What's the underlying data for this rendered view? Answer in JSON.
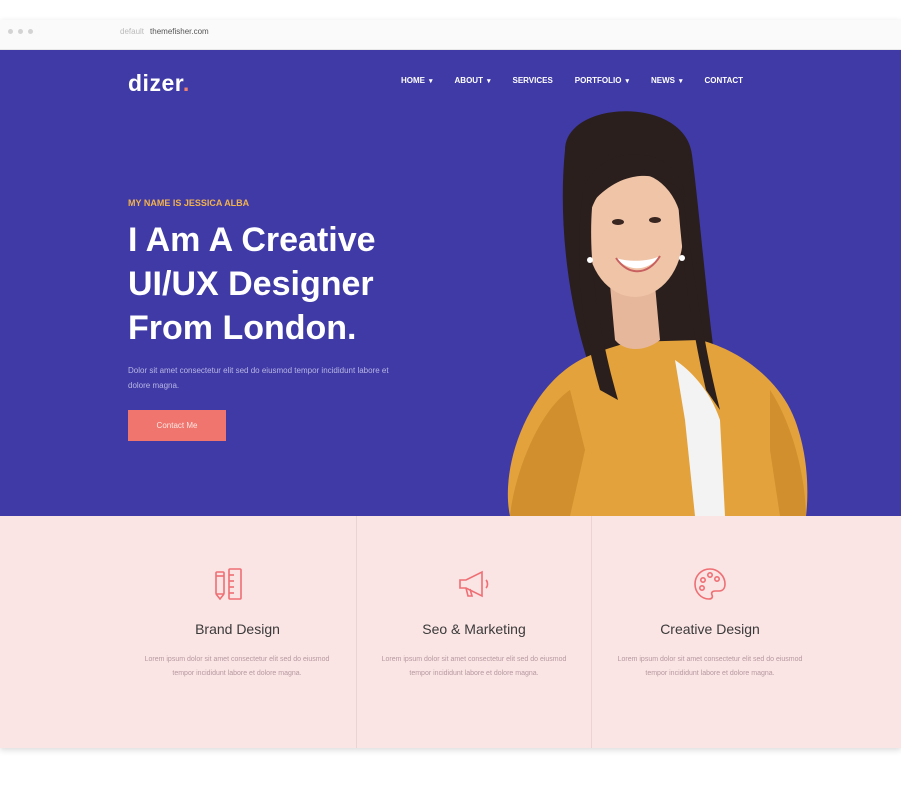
{
  "browser": {
    "url_badge": "default",
    "domain": "themefisher.com"
  },
  "brand": {
    "name": "dizer",
    "dot": "."
  },
  "nav": [
    {
      "label": "HOME",
      "has_dropdown": true
    },
    {
      "label": "ABOUT",
      "has_dropdown": true
    },
    {
      "label": "SERVICES",
      "has_dropdown": false
    },
    {
      "label": "PORTFOLIO",
      "has_dropdown": true
    },
    {
      "label": "NEWS",
      "has_dropdown": true
    },
    {
      "label": "CONTACT",
      "has_dropdown": false
    }
  ],
  "hero": {
    "tagline": "MY NAME IS JESSICA ALBA",
    "headline": [
      "I Am A Creative",
      "UI/UX Designer",
      "From London."
    ],
    "description": "Dolor sit amet consectetur elit sed do eiusmod tempor incididunt labore et dolore magna.",
    "cta_label": "Contact Me"
  },
  "services": [
    {
      "title": "Brand Design",
      "icon": "pencil-ruler-icon",
      "text": "Lorem ipsum dolor sit amet consectetur elit sed do eiusmod tempor incididunt labore et dolore magna."
    },
    {
      "title": "Seo & Marketing",
      "icon": "megaphone-icon",
      "text": "Lorem ipsum dolor sit amet consectetur elit sed do eiusmod tempor incididunt labore et dolore magna."
    },
    {
      "title": "Creative Design",
      "icon": "palette-icon",
      "text": "Lorem ipsum dolor sit amet consectetur elit sed do eiusmod tempor incididunt labore et dolore magna."
    }
  ],
  "colors": {
    "hero_bg": "#3f3aa6",
    "accent": "#f0756e",
    "tagline": "#f2b24c",
    "services_bg": "#fbe4e4"
  }
}
